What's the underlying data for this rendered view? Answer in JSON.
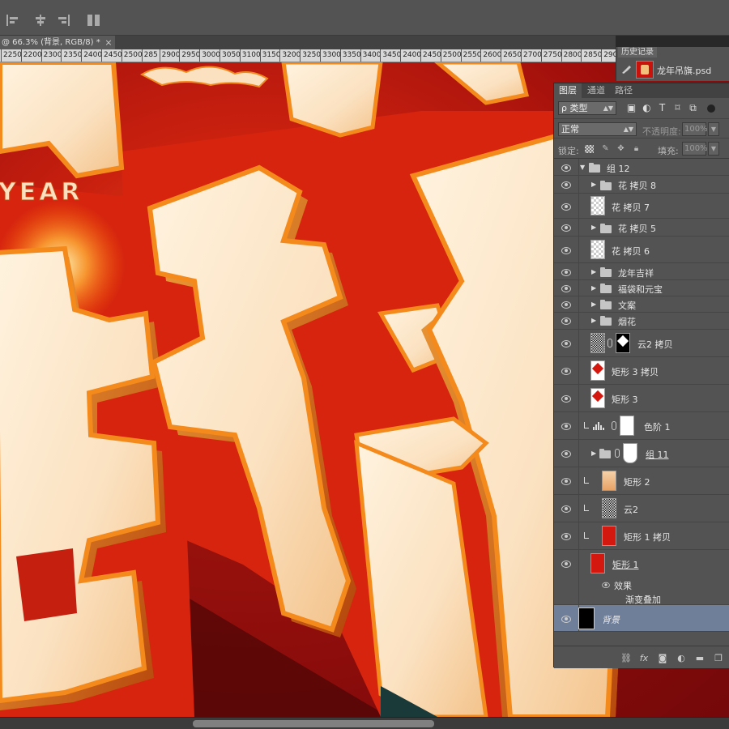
{
  "colors": {
    "panel_bg": "#535353",
    "selected_row": "#6f7f9a",
    "canvas_red": "#c9200f",
    "text_cream": "#fbe1c0",
    "text_orange": "#f58a1c"
  },
  "document": {
    "tab_title": "@ 66.3% (背景, RGB/8) *",
    "close_glyph": "×"
  },
  "ruler": {
    "ticks": [
      "2250",
      "2200",
      "2300",
      "2350",
      "2400",
      "2450",
      "2500",
      "285",
      "2900",
      "2950",
      "3000",
      "3050",
      "3100",
      "3150",
      "3200",
      "3250",
      "3300",
      "3350",
      "3400",
      "3450",
      "2400",
      "2450",
      "2500",
      "2550",
      "2600",
      "2650",
      "2700",
      "2750",
      "2800",
      "2850",
      "2900",
      "2950",
      "3000",
      "3050",
      "31003100",
      "33503350",
      "3450"
    ]
  },
  "canvas_text": {
    "year_word": "YEAR"
  },
  "history": {
    "tab_label": "历史记录",
    "file_name": "龙年吊旗.psd"
  },
  "layers_panel": {
    "tabs": [
      "图层",
      "通道",
      "路径"
    ],
    "filter_kind": "ρ 类型",
    "filter_icons": [
      "image-filter-icon",
      "adjust-filter-icon",
      "type-filter-icon",
      "shape-filter-icon",
      "smartobject-filter-icon"
    ],
    "blend_mode": "正常",
    "opacity_label": "不透明度:",
    "opacity_value": "100%",
    "lock_label": "锁定:",
    "fill_label": "填充:",
    "fill_value": "100%",
    "layers": [
      {
        "name": "组 12",
        "kind": "group",
        "expanded": true
      },
      {
        "name": "花 拷贝 8",
        "kind": "group"
      },
      {
        "name": "花 拷贝 7",
        "kind": "pixel"
      },
      {
        "name": "花 拷贝 5",
        "kind": "group"
      },
      {
        "name": "花 拷贝 6",
        "kind": "pixel"
      },
      {
        "name": "龙年吉祥",
        "kind": "group"
      },
      {
        "name": "福袋和元宝",
        "kind": "group"
      },
      {
        "name": "文案",
        "kind": "group"
      },
      {
        "name": "烟花",
        "kind": "group"
      },
      {
        "name": "云2 拷贝",
        "kind": "masked"
      },
      {
        "name": "矩形 3 拷贝",
        "kind": "shape"
      },
      {
        "name": "矩形 3",
        "kind": "shape"
      },
      {
        "name": "色阶 1",
        "kind": "adjustment"
      },
      {
        "name": "组 11",
        "kind": "masked-group"
      },
      {
        "name": "矩形 2",
        "kind": "shape"
      },
      {
        "name": "云2",
        "kind": "pixel"
      },
      {
        "name": "矩形 1 拷贝",
        "kind": "shape"
      },
      {
        "name": "矩形 1",
        "kind": "shape"
      },
      {
        "name": "效果",
        "kind": "effects"
      },
      {
        "name": "渐变叠加",
        "kind": "effect"
      },
      {
        "name": "背景",
        "kind": "background",
        "selected": true
      }
    ],
    "bottom_icons": [
      "link-layers-icon",
      "fx-icon",
      "add-mask-icon",
      "new-adjustment-icon",
      "new-group-icon",
      "new-layer-icon"
    ]
  }
}
